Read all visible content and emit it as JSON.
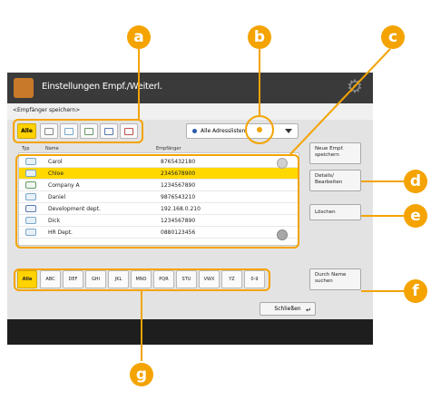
{
  "window": {
    "title": "Einstellungen Empf./Weiterl.",
    "subtitle": "<Empfänger speichern>"
  },
  "type_filters": [
    {
      "label": "Alle",
      "selected": true,
      "icon": "all"
    },
    {
      "label": "",
      "selected": false,
      "icon": "email-icon"
    },
    {
      "label": "",
      "selected": false,
      "icon": "ifax-icon"
    },
    {
      "label": "",
      "selected": false,
      "icon": "fax-icon"
    },
    {
      "label": "",
      "selected": false,
      "icon": "file-icon"
    },
    {
      "label": "",
      "selected": false,
      "icon": "group-icon"
    }
  ],
  "address_list": {
    "selected": "Alle Adresslisten"
  },
  "table": {
    "col_type": "Typ",
    "col_name": "Name",
    "col_dest": "Empfänger",
    "rows": [
      {
        "name": "Carol",
        "dest": "8765432180",
        "selected": false
      },
      {
        "name": "Chloe",
        "dest": "2345678900",
        "selected": true
      },
      {
        "name": "Company A",
        "dest": "1234567890",
        "selected": false
      },
      {
        "name": "Daniel",
        "dest": "9876543210",
        "selected": false
      },
      {
        "name": "Development dept.",
        "dest": "192.168.0.210",
        "selected": false
      },
      {
        "name": "Dick",
        "dest": "1234567890",
        "selected": false
      },
      {
        "name": "HR Dept.",
        "dest": "0880123456",
        "selected": false
      }
    ]
  },
  "side_buttons": {
    "new_line1": "Neue Empf.",
    "new_line2": "speichern",
    "details_line1": "Details/",
    "details_line2": "Bearbeiten",
    "delete": "Löschen",
    "search_line1": "Durch Name",
    "search_line2": "suchen"
  },
  "letter_index": [
    "Alle",
    "ABC",
    "DEF",
    "GHI",
    "JKL",
    "MNO",
    "PQR",
    "STU",
    "VWX",
    "YZ",
    "0-9"
  ],
  "close_label": "Schließen",
  "callouts": {
    "a": "a",
    "b": "b",
    "c": "c",
    "d": "d",
    "e": "e",
    "f": "f",
    "g": "g"
  },
  "colors": {
    "accent": "#f4a300",
    "selection": "#ffd800",
    "titlebar": "#3a3a3a"
  }
}
